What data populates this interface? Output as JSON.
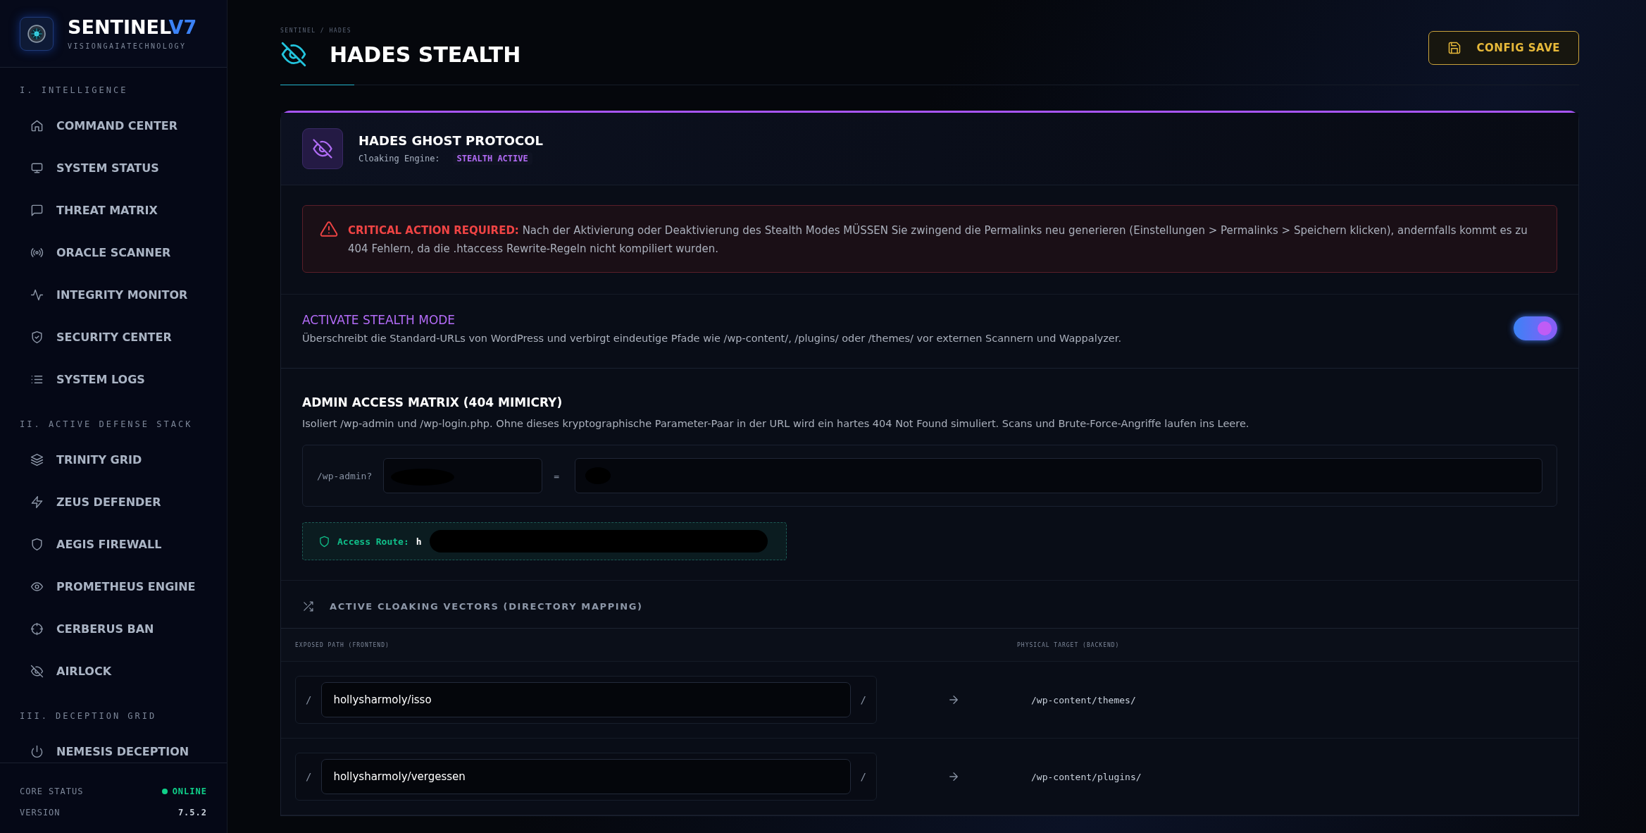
{
  "sidebar": {
    "brand": {
      "name": "SENTINEL",
      "version_mark": "V7",
      "tagline": "VISIONGAIATECHNOLOGY"
    },
    "sections": [
      {
        "title": "I. INTELLIGENCE",
        "items": [
          {
            "label": "COMMAND CENTER"
          },
          {
            "label": "SYSTEM STATUS"
          },
          {
            "label": "THREAT MATRIX"
          },
          {
            "label": "ORACLE SCANNER"
          },
          {
            "label": "INTEGRITY MONITOR"
          },
          {
            "label": "SECURITY CENTER"
          },
          {
            "label": "SYSTEM LOGS"
          }
        ]
      },
      {
        "title": "II. ACTIVE DEFENSE STACK",
        "items": [
          {
            "label": "TRINITY GRID"
          },
          {
            "label": "ZEUS DEFENDER"
          },
          {
            "label": "AEGIS FIREWALL"
          },
          {
            "label": "PROMETHEUS ENGINE"
          },
          {
            "label": "CERBERUS BAN"
          },
          {
            "label": "AIRLOCK"
          }
        ]
      },
      {
        "title": "III. DECEPTION GRID",
        "items": [
          {
            "label": "NEMESIS DECEPTION"
          }
        ]
      }
    ],
    "footer": [
      {
        "label": "CORE STATUS",
        "value": "ONLINE",
        "kind": "status"
      },
      {
        "label": "VERSION",
        "value": "7.5.2",
        "kind": "text"
      }
    ]
  },
  "header": {
    "breadcrumb": "SENTINEL / HADES",
    "title": "HADES STEALTH",
    "save_button": "CONFIG SAVE"
  },
  "card": {
    "title": "HADES GHOST PROTOCOL",
    "engine_label": "Cloaking Engine:",
    "engine_status": "STEALTH ACTIVE",
    "alert": "**CRITICAL ACTION REQUIRED:** Nach der Aktivierung oder Deaktivierung des Stealth Modes MÜSSEN Sie zwingend die Permalinks neu generieren (Einstellungen > Permalinks > Speichern klicken), andernfalls kommt es zu 404 Fehlern, da die .htaccess Rewrite-Regeln nicht kompiliert wurden.",
    "stealth": {
      "title": "ACTIVATE STEALTH MODE",
      "description": "Überschreibt die Standard-URLs von WordPress und verbirgt eindeutige Pfade wie /wp-content/, /plugins/ oder /themes/ vor externen Scannern und Wappalyzer.",
      "on": true
    },
    "admin": {
      "title": "ADMIN ACCESS MATRIX (404 MIMICRY)",
      "description": "Isoliert /wp-admin und /wp-login.php. Ohne dieses kryptographische Parameter-Paar in der URL wird ein hartes 404 Not Found simuliert. Scans und Brute-Force-Angriffe laufen ins Leere.",
      "param_prefix": "/wp-admin?",
      "separator": "=",
      "route_label": "Access Route:",
      "route_value": "h"
    },
    "vectors": {
      "title": "ACTIVE CLOAKING VECTORS (DIRECTORY MAPPING)",
      "columns": [
        "EXPOSED PATH (FRONTEND)",
        "PHYSICAL TARGET (BACKEND)"
      ],
      "rows": [
        {
          "prefix": "/",
          "value": "hollysharmoly/isso",
          "suffix": "/",
          "target": "/wp-content/themes/"
        },
        {
          "prefix": "/",
          "value": "hollysharmoly/vergessen",
          "suffix": "/",
          "target": "/wp-content/plugins/"
        }
      ]
    }
  }
}
